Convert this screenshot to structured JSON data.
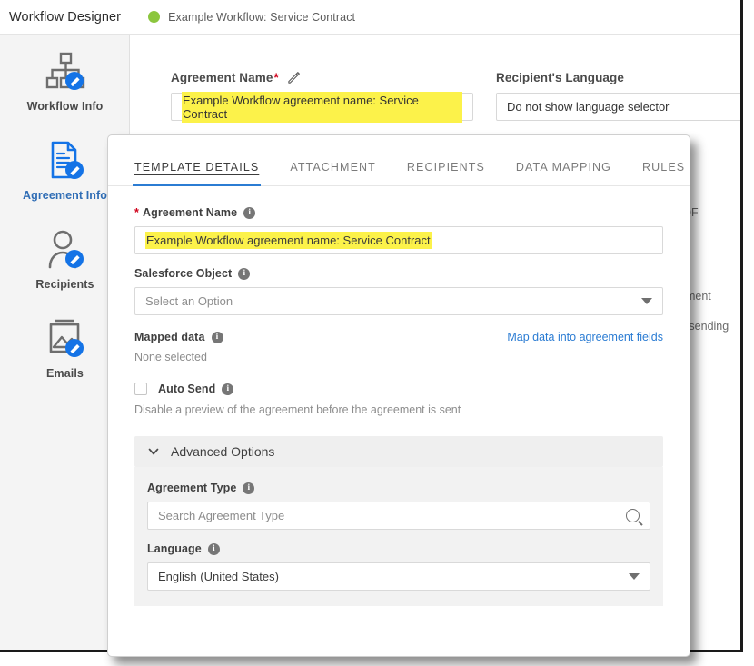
{
  "topbar": {
    "app_title": "Workflow Designer",
    "status_icon": "green-status-dot",
    "status_color": "#8cc63e",
    "workflow_name": "Example Workflow: Service Contract"
  },
  "sidebar": {
    "items": [
      {
        "label": "Workflow Info",
        "icon": "workflow-hierarchy-icon",
        "active": false
      },
      {
        "label": "Agreement Info",
        "icon": "document-edit-icon",
        "active": true
      },
      {
        "label": "Recipients",
        "icon": "person-edit-icon",
        "active": false
      },
      {
        "label": "Emails",
        "icon": "email-image-edit-icon",
        "active": false
      }
    ]
  },
  "main": {
    "agreement_name": {
      "label": "Agreement Name",
      "required_marker": "*",
      "edit_icon": "pencil-icon",
      "value": "Example Workflow agreement name: Service Contract",
      "highlight_color": "#fcf24a"
    },
    "recipients_language": {
      "label": "Recipient's Language",
      "value": "Do not show language selector"
    },
    "obscured_text": [
      {
        "text": "DF"
      },
      {
        "text": "ement"
      },
      {
        "text": "o sending"
      }
    ]
  },
  "modal": {
    "tabs": [
      {
        "label": "TEMPLATE DETAILS",
        "active": true
      },
      {
        "label": "ATTACHMENT",
        "active": false
      },
      {
        "label": "RECIPIENTS",
        "active": false
      },
      {
        "label": "DATA MAPPING",
        "active": false
      },
      {
        "label": "RULES",
        "active": false
      }
    ],
    "active_tab_color": "#2b7cd3",
    "agreement_name": {
      "required_marker": "*",
      "label": "Agreement Name",
      "info_icon": "info-icon",
      "value": "Example Workflow agreement name: Service Contract",
      "highlight_color": "#fcf24a"
    },
    "salesforce_object": {
      "label": "Salesforce Object",
      "info_icon": "info-icon",
      "placeholder": "Select an Option",
      "dropdown_icon": "chevron-down-icon"
    },
    "mapped_data": {
      "label": "Mapped data",
      "info_icon": "info-icon",
      "link_label": "Map data into agreement fields",
      "link_color": "#2b7cd3",
      "value": "None selected"
    },
    "auto_send": {
      "label": "Auto Send",
      "info_icon": "info-icon",
      "checked": false,
      "description": "Disable a preview of the agreement before the agreement is sent"
    },
    "advanced_options": {
      "title": "Advanced Options",
      "expand_icon": "chevron-down-icon",
      "expanded": true,
      "agreement_type": {
        "label": "Agreement Type",
        "info_icon": "info-icon",
        "placeholder": "Search Agreement Type",
        "search_icon": "search-icon"
      },
      "language": {
        "label": "Language",
        "info_icon": "info-icon",
        "value": "English (United States)",
        "dropdown_icon": "chevron-down-icon"
      }
    }
  }
}
